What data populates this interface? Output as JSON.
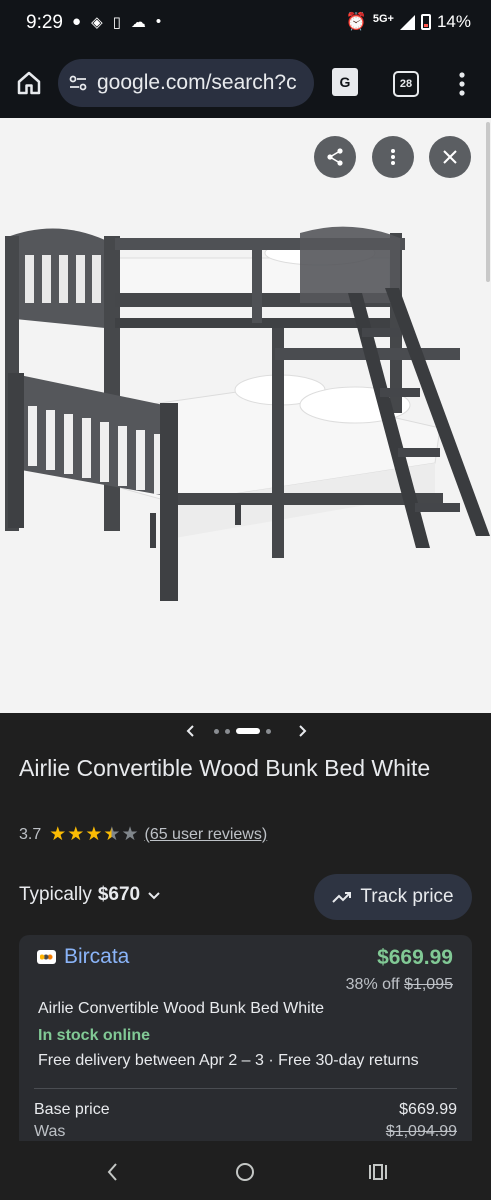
{
  "status_bar": {
    "time": "9:29",
    "network": "5G+",
    "battery": "14%"
  },
  "browser": {
    "url": "google.com/search?c",
    "tab_count": "28",
    "translate_label": "G"
  },
  "product": {
    "title": "Airlie Convertible Wood Bunk Bed White",
    "rating": "3.7",
    "stars_value": 3.7,
    "reviews": "(65 user reviews)",
    "typically_label": "Typically",
    "typically_price": "$670",
    "track_price": "Track price"
  },
  "carousel": {
    "slide_count": 4,
    "active_index": 2
  },
  "offer": {
    "merchant": "Bircata",
    "price": "$669.99",
    "discount": "38% off",
    "original_price": "$1,095",
    "title": "Airlie Convertible Wood Bunk Bed White",
    "stock": "In stock online",
    "delivery": "Free delivery between Apr 2 – 3 · Free 30-day returns",
    "base_price_label": "Base price",
    "base_price_value": "$669.99",
    "was_label": "Was",
    "was_value": "$1,094.99"
  },
  "colors": {
    "background": "#1f1f1f",
    "accent_link": "#8ab4f8",
    "price_green": "#81c995",
    "star": "#fbbc04"
  }
}
